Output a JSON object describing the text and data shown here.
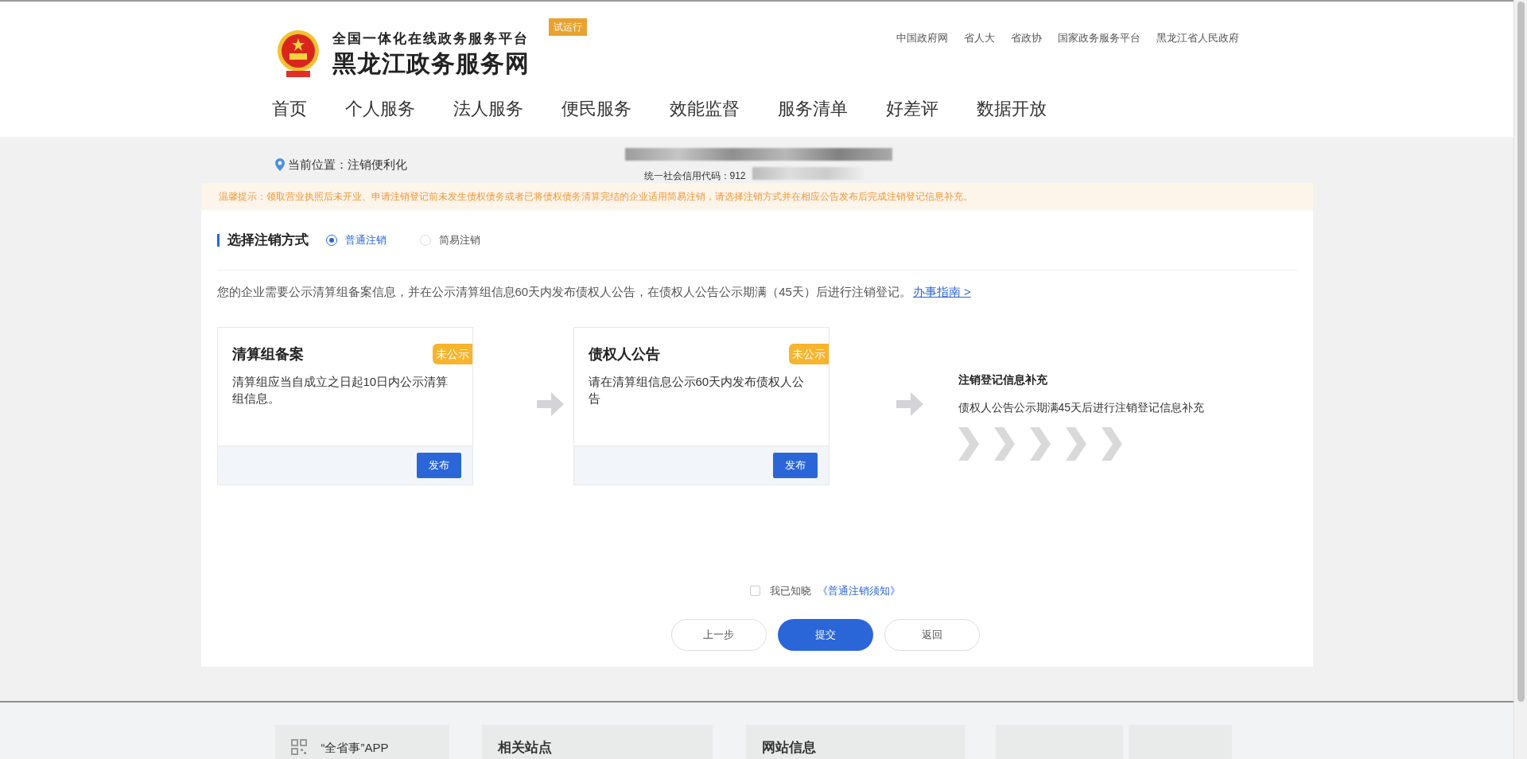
{
  "header": {
    "subtitle": "全国一体化在线政务服务平台",
    "title": "黑龙江政务服务网",
    "badge": "试运行",
    "top_links": [
      "中国政府网",
      "省人大",
      "省政协",
      "国家政务服务平台",
      "黑龙江省人民政府"
    ],
    "nav": [
      "首页",
      "个人服务",
      "法人服务",
      "便民服务",
      "效能监督",
      "服务清单",
      "好差评",
      "数据开放"
    ]
  },
  "breadcrumb": "当前位置：注销便利化",
  "company": {
    "credit_code": "统一社会信用代码：912"
  },
  "notice": "温馨提示：领取营业执照后未开业、申请注销登记前未发生债权债务或者已将债权债务清算完结的企业适用简易注销，请选择注销方式并在相应公告发布后完成注销登记信息补充。",
  "method": {
    "title": "选择注销方式",
    "options": [
      {
        "label": "普通注销",
        "selected": true
      },
      {
        "label": "简易注销",
        "selected": false
      }
    ]
  },
  "description": {
    "text": "您的企业需要公示清算组备案信息，并在公示清算组信息60天内发布债权人公告，在债权人公告公示期满（45天）后进行注销登记。",
    "link": "办事指南 >"
  },
  "steps": [
    {
      "kind": "card",
      "title": "清算组备案",
      "status": "未公示",
      "text": "清算组应当自成立之日起10日内公示清算组信息。",
      "button": "发布"
    },
    {
      "kind": "card",
      "title": "债权人公告",
      "status": "未公示",
      "text": "请在清算组信息公示60天内发布债权人公告",
      "button": "发布"
    },
    {
      "kind": "final",
      "title": "注销登记信息补充",
      "text": "债权人公告公示期满45天后进行注销登记信息补充"
    }
  ],
  "agreement": {
    "checked": false,
    "label": "我已知晓",
    "link": "《普通注销须知》"
  },
  "buttons": [
    {
      "label": "上一步",
      "kind": "secondary"
    },
    {
      "label": "提交",
      "kind": "primary"
    },
    {
      "label": "返回",
      "kind": "secondary"
    }
  ],
  "footer": {
    "cards": [
      {
        "kind": "app",
        "title": "“全省事”APP"
      },
      {
        "kind": "plain",
        "title": "相关站点"
      },
      {
        "kind": "plain",
        "title": "网站信息"
      },
      {
        "kind": "empty"
      },
      {
        "kind": "empty"
      }
    ]
  }
}
